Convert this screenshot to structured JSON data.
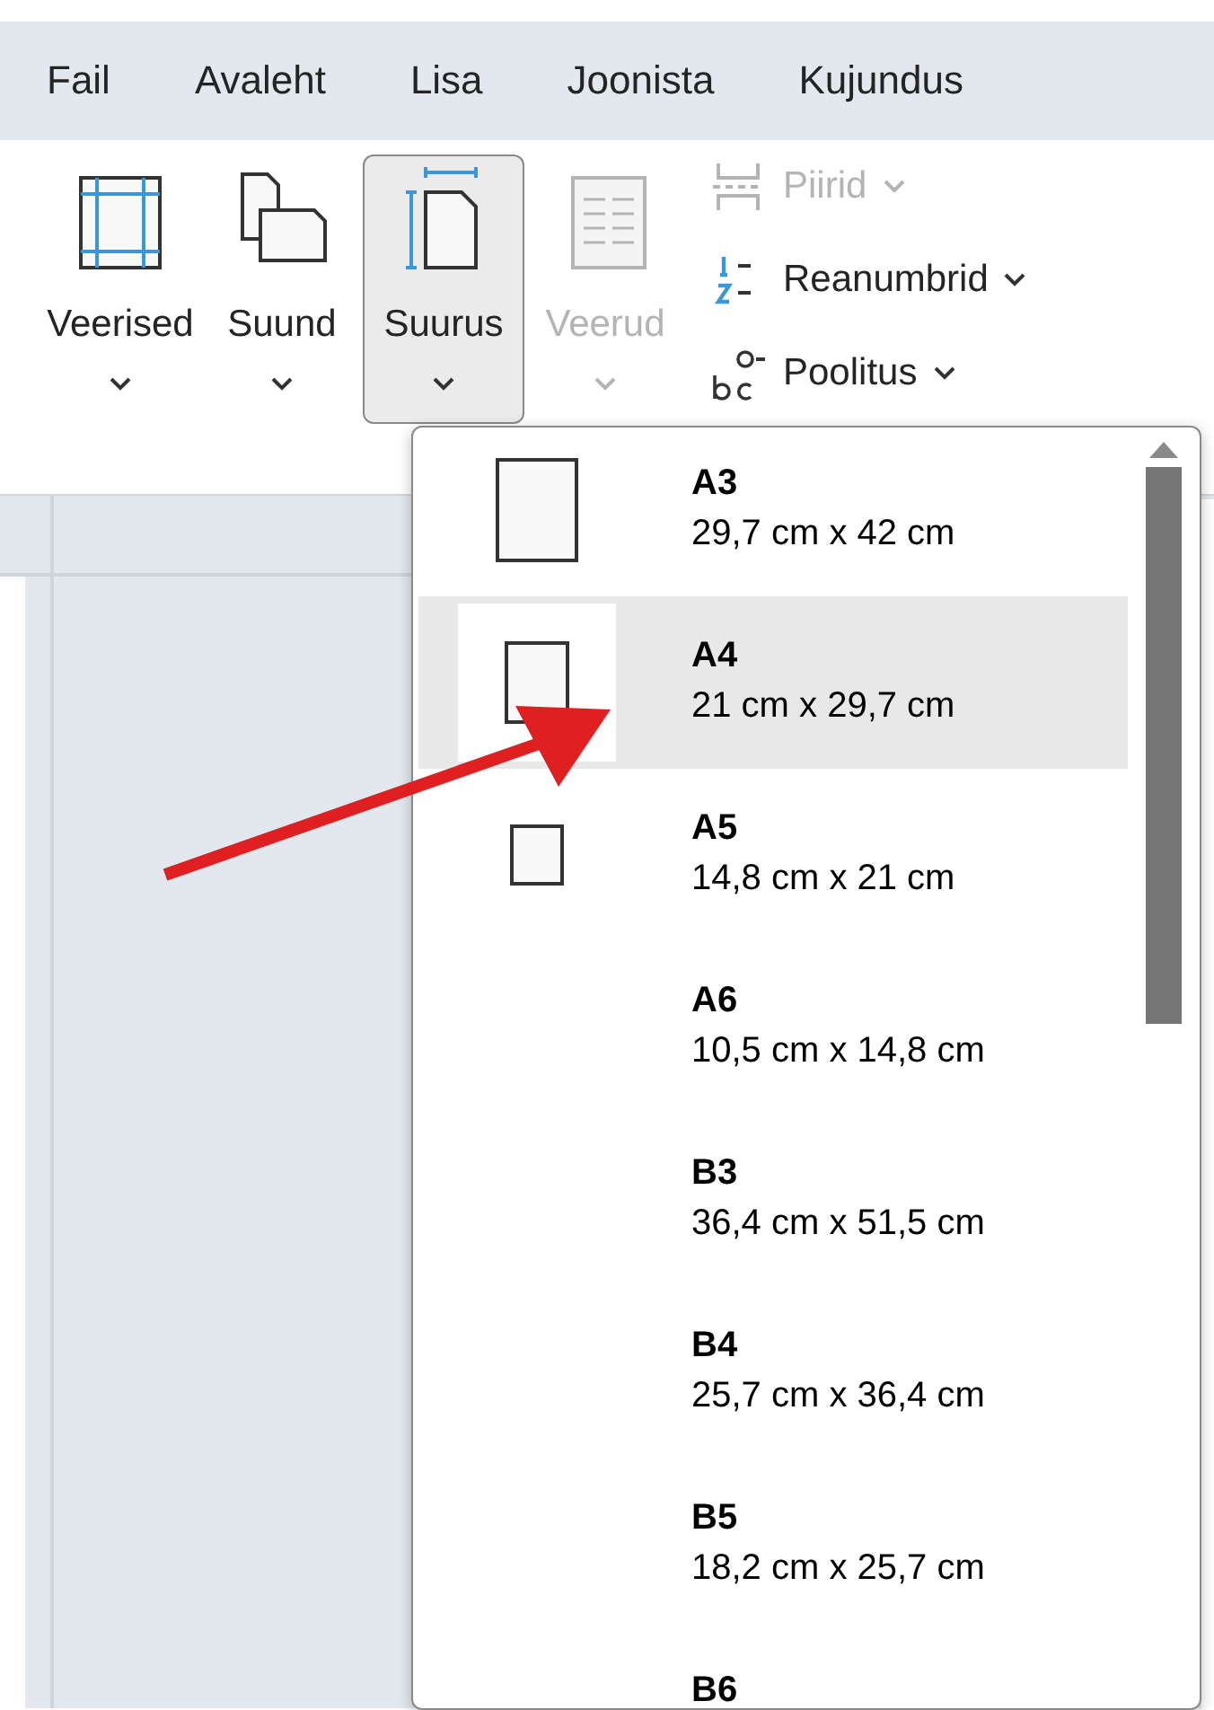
{
  "tabs": [
    {
      "label": "Fail",
      "selected": false
    },
    {
      "label": "Avaleht",
      "selected": false
    },
    {
      "label": "Lisa",
      "selected": false
    },
    {
      "label": "Joonista",
      "selected": false
    },
    {
      "label": "Kujundus",
      "selected": false
    }
  ],
  "ribbon": {
    "large_buttons": [
      {
        "label": "Veerised",
        "kind": "margins",
        "pressed": false,
        "disabled": false
      },
      {
        "label": "Suund",
        "kind": "orientation",
        "pressed": false,
        "disabled": false
      },
      {
        "label": "Suurus",
        "kind": "size",
        "pressed": true,
        "disabled": false
      },
      {
        "label": "Veerud",
        "kind": "columns",
        "pressed": false,
        "disabled": true
      }
    ],
    "small_buttons": [
      {
        "label": "Piirid",
        "kind": "breaks",
        "disabled": true
      },
      {
        "label": "Reanumbrid",
        "kind": "line-numbers",
        "disabled": false
      },
      {
        "label": "Poolitus",
        "kind": "hyphenation",
        "disabled": false
      }
    ]
  },
  "size_menu": {
    "items": [
      {
        "name": "A3",
        "size": "29,7 cm x 42 cm",
        "kind": "large",
        "selected": false
      },
      {
        "name": "A4",
        "size": "21 cm x 29,7 cm",
        "kind": "medium",
        "selected": true
      },
      {
        "name": "A5",
        "size": "14,8 cm x 21 cm",
        "kind": "small",
        "selected": false
      },
      {
        "name": "A6",
        "size": "10,5 cm x 14,8 cm",
        "kind": "plain",
        "selected": false
      },
      {
        "name": "B3",
        "size": "36,4 cm x 51,5 cm",
        "kind": "plain",
        "selected": false
      },
      {
        "name": "B4",
        "size": "25,7 cm x 36,4 cm",
        "kind": "plain",
        "selected": false
      },
      {
        "name": "B5",
        "size": "18,2 cm x 25,7 cm",
        "kind": "plain",
        "selected": false
      },
      {
        "name": "B6",
        "kind": "plain",
        "selected": false
      }
    ]
  }
}
